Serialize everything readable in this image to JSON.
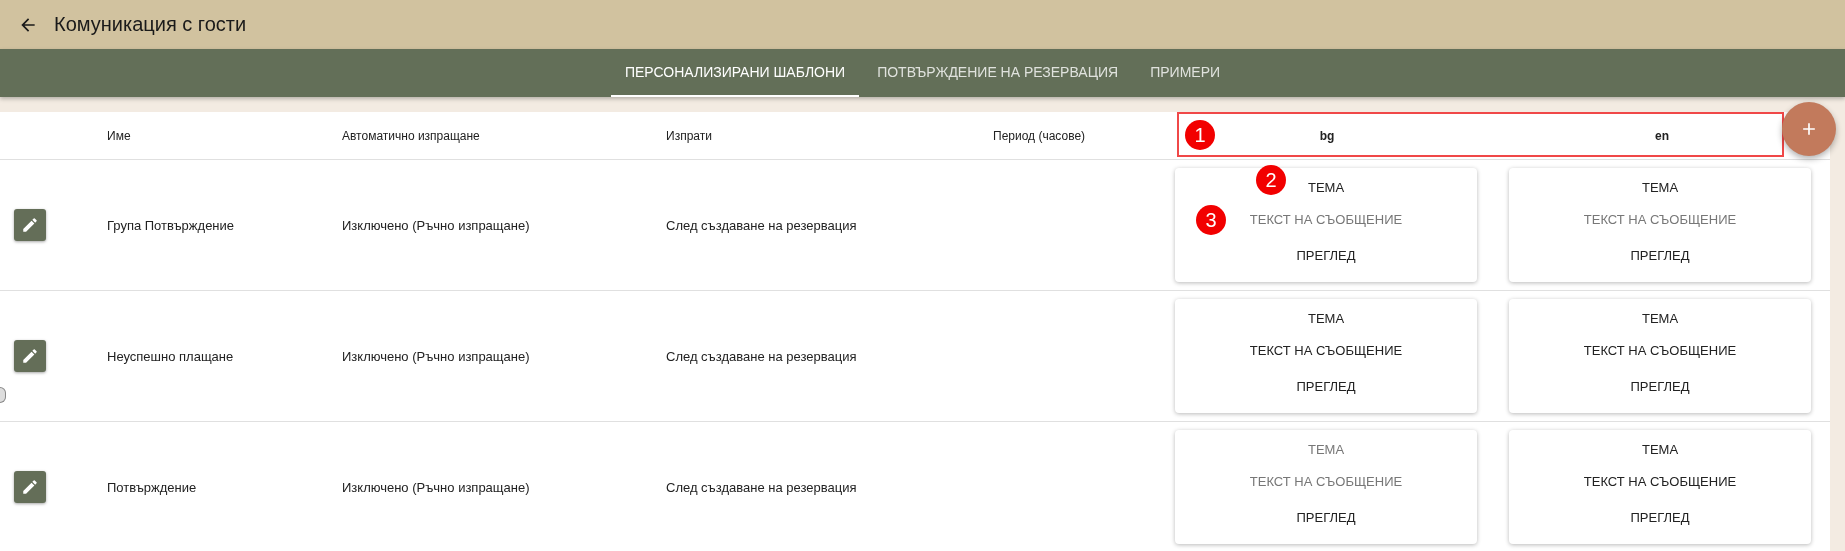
{
  "header": {
    "title": "Комуникация с гости"
  },
  "tabs": [
    {
      "label": "ПЕРСОНАЛИЗИРАНИ ШАБЛОНИ",
      "selected": true
    },
    {
      "label": "ПОТВЪРЖДЕНИЕ НА РЕЗЕРВАЦИЯ",
      "selected": false
    },
    {
      "label": "ПРИМЕРИ",
      "selected": false
    }
  ],
  "table": {
    "columns": [
      "Име",
      "Автоматично изпращане",
      "Изпрати",
      "Период (часове)",
      "bg",
      "en"
    ],
    "rows": [
      {
        "name": "Група Потвърждение",
        "auto_send": "Изключено (Ръчно изпращане)",
        "send": "След създаване на резервация",
        "templates": [
          {
            "subject": "ТЕМА",
            "subject_filled": true,
            "message": "ТЕКСТ НА СЪОБЩЕНИЕ",
            "message_filled": false,
            "preview": "ПРЕГЛЕД"
          },
          {
            "subject": "ТЕМА",
            "subject_filled": true,
            "message": "ТЕКСТ НА СЪОБЩЕНИЕ",
            "message_filled": false,
            "preview": "ПРЕГЛЕД"
          }
        ]
      },
      {
        "name": "Неуспешно плащане",
        "auto_send": "Изключено (Ръчно изпращане)",
        "send": "След създаване на резервация",
        "templates": [
          {
            "subject": "ТЕМА",
            "subject_filled": true,
            "message": "ТЕКСТ НА СЪОБЩЕНИЕ",
            "message_filled": true,
            "preview": "ПРЕГЛЕД"
          },
          {
            "subject": "ТЕМА",
            "subject_filled": true,
            "message": "ТЕКСТ НА СЪОБЩЕНИЕ",
            "message_filled": true,
            "preview": "ПРЕГЛЕД"
          }
        ]
      },
      {
        "name": "Потвърждение",
        "auto_send": "Изключено (Ръчно изпращане)",
        "send": "След създаване на резервация",
        "templates": [
          {
            "subject": "ТЕМА",
            "subject_filled": false,
            "message": "ТЕКСТ НА СЪОБЩЕНИЕ",
            "message_filled": false,
            "preview": "ПРЕГЛЕД"
          },
          {
            "subject": "ТЕМА",
            "subject_filled": true,
            "message": "ТЕКСТ НА СЪОБЩЕНИЕ",
            "message_filled": true,
            "preview": "ПРЕГЛЕД"
          }
        ]
      }
    ]
  },
  "annotations": [
    {
      "kind": "box"
    },
    {
      "kind": "marker",
      "label": "1"
    },
    {
      "kind": "marker",
      "label": "2"
    },
    {
      "kind": "marker",
      "label": "3"
    }
  ]
}
